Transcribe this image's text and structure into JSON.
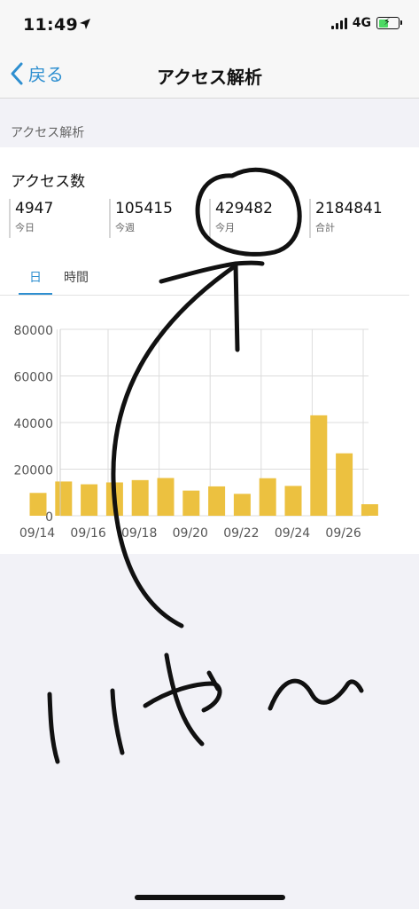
{
  "status": {
    "time": "11:49",
    "network": "4G",
    "battery_level": 0.55,
    "battery_color": "#4cd964"
  },
  "nav": {
    "back_label": "戻る",
    "title": "アクセス解析"
  },
  "section_header": "アクセス解析",
  "card": {
    "title": "アクセス数",
    "stats": [
      {
        "value": "4947",
        "label": "今日"
      },
      {
        "value": "105415",
        "label": "今週"
      },
      {
        "value": "429482",
        "label": "今月"
      },
      {
        "value": "2184841",
        "label": "合計"
      }
    ]
  },
  "tabs": [
    {
      "label": "日",
      "active": true
    },
    {
      "label": "時間",
      "active": false
    }
  ],
  "colors": {
    "accent": "#2e8fd0",
    "bar": "#ecc140"
  },
  "chart_data": {
    "type": "bar",
    "categories": [
      "09/14",
      "09/15",
      "09/16",
      "09/17",
      "09/18",
      "09/19",
      "09/20",
      "09/21",
      "09/22",
      "09/23",
      "09/24",
      "09/25",
      "09/26",
      "09/27"
    ],
    "values": [
      9800,
      14700,
      13500,
      14300,
      15300,
      16200,
      10800,
      12600,
      9400,
      16100,
      12800,
      43100,
      26800,
      4947
    ],
    "x_tick_labels": [
      "09/14",
      "09/16",
      "09/18",
      "09/20",
      "09/22",
      "09/24",
      "09/26"
    ],
    "y_ticks": [
      0,
      20000,
      40000,
      60000,
      80000
    ],
    "ylim": [
      0,
      80000
    ],
    "grid": true
  },
  "annotation": {
    "handwriting": "いや〜",
    "stroke_color": "#111111"
  }
}
